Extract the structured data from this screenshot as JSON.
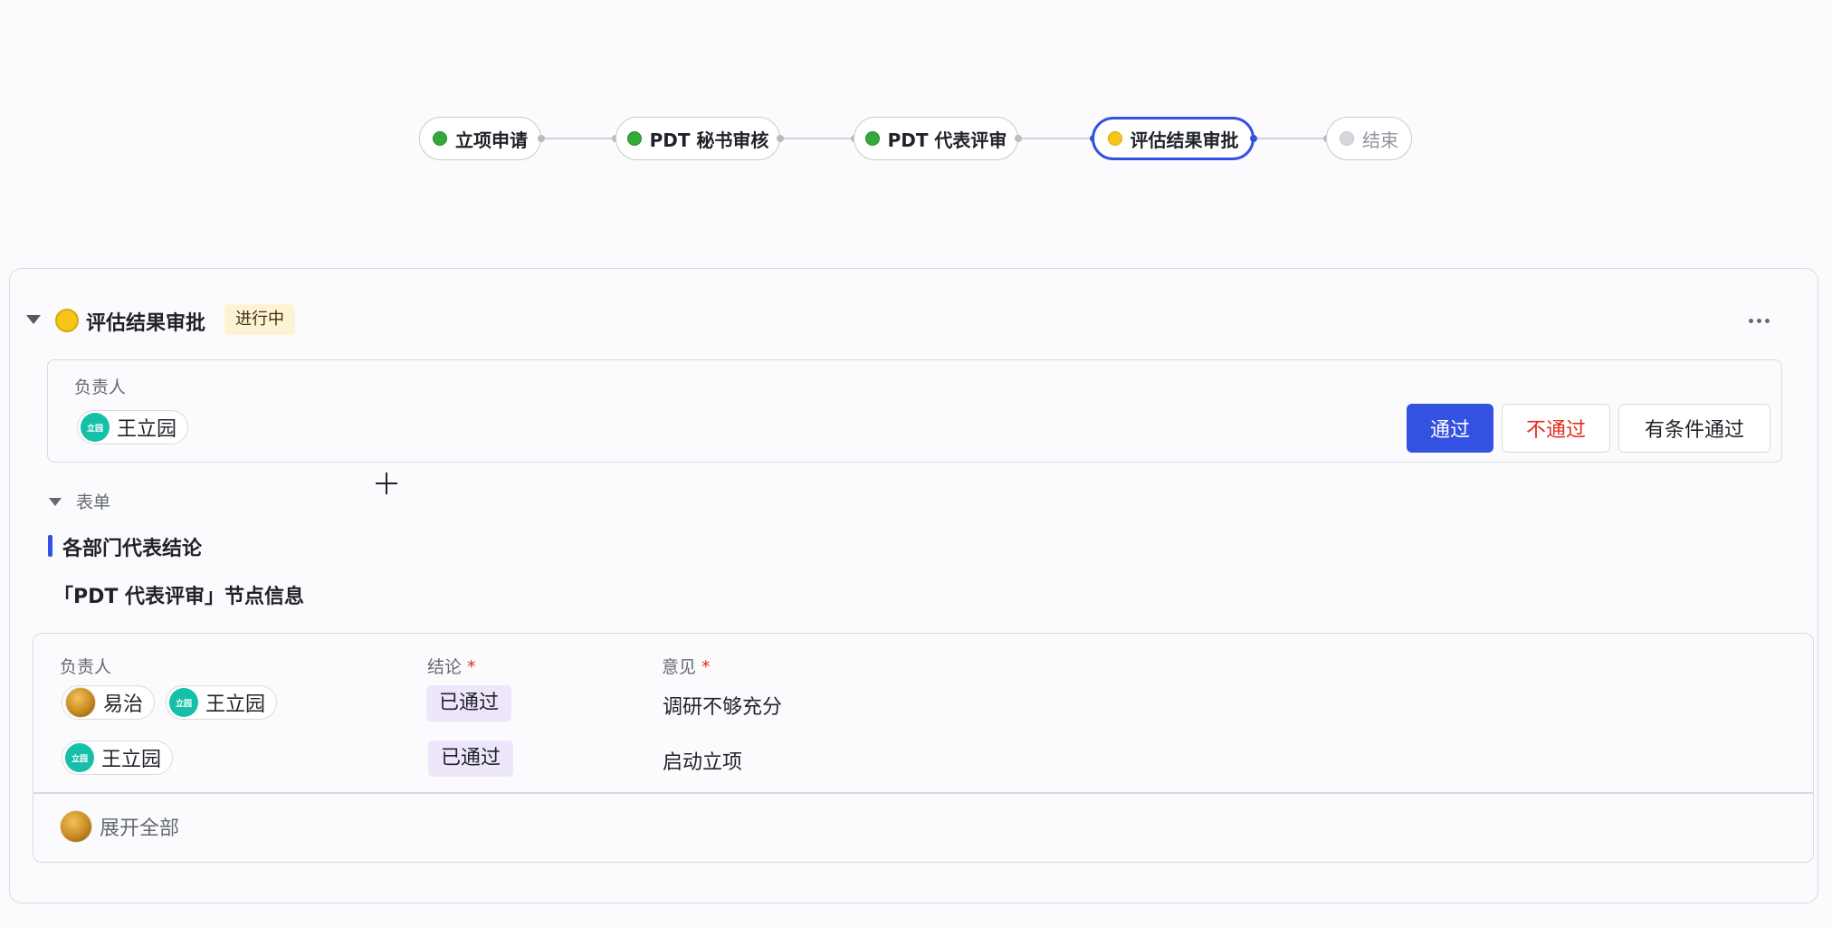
{
  "workflow": {
    "nodes": [
      {
        "label": "立项申请",
        "status": "done"
      },
      {
        "label": "PDT 秘书审核",
        "status": "done"
      },
      {
        "label": "PDT 代表评审",
        "status": "done"
      },
      {
        "label": "评估结果审批",
        "status": "in-progress"
      },
      {
        "label": "结束",
        "status": "pending"
      }
    ]
  },
  "stage": {
    "title": "评估结果审批",
    "status_tag": "进行中",
    "more_icon": "more-horizontal-icon"
  },
  "owner_section": {
    "label": "负责人",
    "owner": {
      "name": "王立园",
      "avatar_text": "立园"
    },
    "actions": {
      "pass": "通过",
      "reject": "不通过",
      "conditional_pass": "有条件通过"
    }
  },
  "form": {
    "toggle_label": "表单",
    "section_title": "各部门代表结论",
    "subtitle": "「PDT 代表评审」节点信息",
    "table": {
      "headers": {
        "owner": "负责人",
        "conclusion": "结论",
        "opinion": "意见",
        "required_mark": "*"
      },
      "rows": [
        {
          "owners": [
            {
              "name": "易治",
              "avatar": "photo"
            },
            {
              "name": "王立园",
              "avatar_text": "立园"
            }
          ],
          "conclusion": "已通过",
          "opinion": "调研不够充分"
        },
        {
          "owners": [
            {
              "name": "王立园",
              "avatar_text": "立园"
            }
          ],
          "conclusion": "已通过",
          "opinion": "启动立项"
        }
      ],
      "expand_label": "展开全部"
    }
  },
  "colors": {
    "primary": "#3452e1",
    "done": "#34a93a",
    "in_progress": "#f5c518",
    "pending": "#d5d8dd",
    "danger": "#e22d1a",
    "tag_progress_bg": "#fdf3d4",
    "badge_passed_bg": "#eee6fa",
    "avatar_teal": "#16c0a8"
  }
}
